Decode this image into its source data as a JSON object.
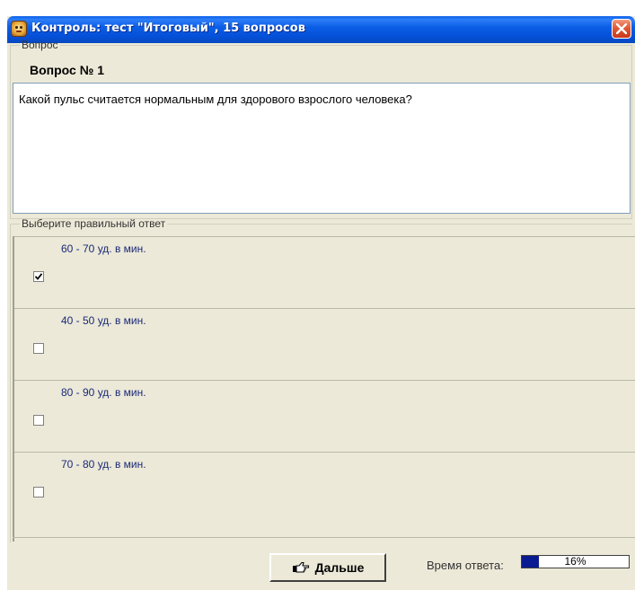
{
  "window": {
    "title": "Контроль: тест \"Итоговый\", 15 вопросов"
  },
  "question": {
    "group_label": "Вопрос",
    "number": "Вопрос № 1",
    "text": "Какой пульс считается нормальным для здорового взрослого человека?"
  },
  "answers": {
    "group_label": "Выберите правильный ответ",
    "options": [
      {
        "label": "60 - 70 уд. в мин.",
        "checked": true
      },
      {
        "label": "40 - 50 уд. в мин.",
        "checked": false
      },
      {
        "label": "80 - 90 уд. в мин.",
        "checked": false
      },
      {
        "label": "70 - 80 уд. в мин.",
        "checked": false
      }
    ]
  },
  "footer": {
    "next_label": "Дальше",
    "time_label": "Время ответа:",
    "time_percent_text": "16%",
    "time_fraction": 0.16
  }
}
